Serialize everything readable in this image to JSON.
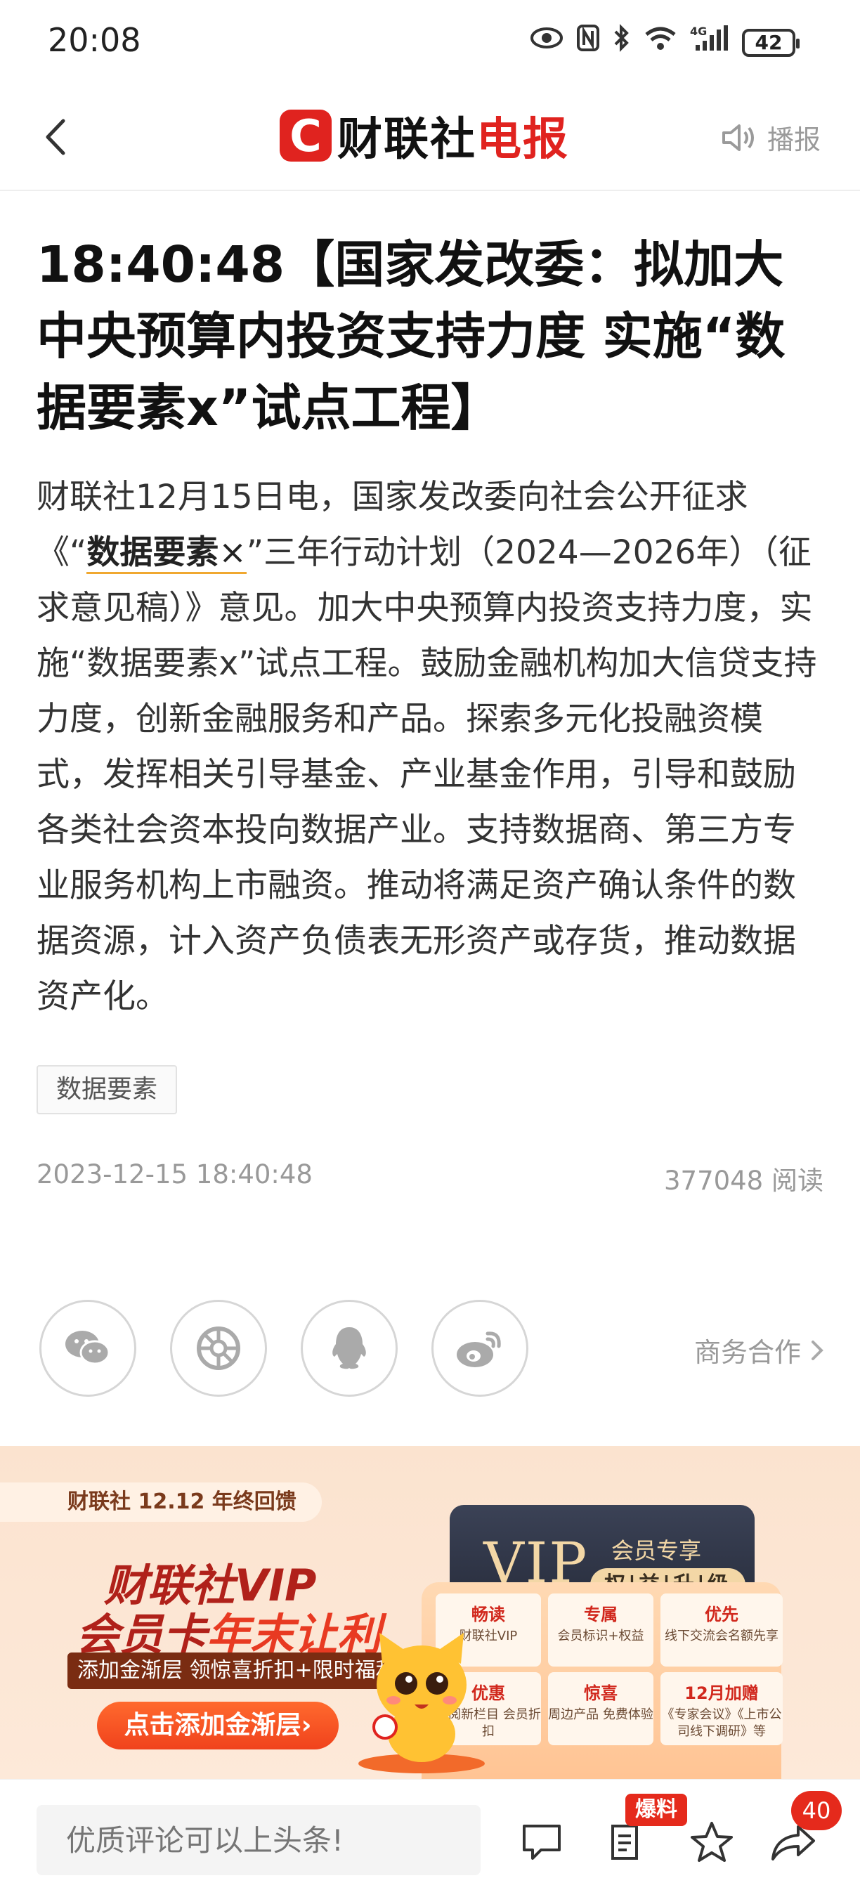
{
  "status_bar": {
    "time": "20:08",
    "network": "4G",
    "battery": "42"
  },
  "header": {
    "logo_mark": "C",
    "logo_text_a": "财联社",
    "logo_text_b": "电报",
    "broadcast_label": "播报"
  },
  "article": {
    "headline": "18:40:48【国家发改委：拟加大中央预算内投资支持力度 实施“数据要素x”试点工程】",
    "body_prefix": "财联社12月15日电，国家发改委向社会公开征求《“",
    "body_keyword": "数据要素",
    "body_keyword_mark": "×",
    "body_rest": "”三年行动计划（2024—2026年）（征求意见稿）》意见。加大中央预算内投资支持力度，实施“数据要素x”试点工程。鼓励金融机构加大信贷支持力度，创新金融服务和产品。探索多元化投融资模式，发挥相关引导基金、产业基金作用，引导和鼓励各类社会资本投向数据产业。支持数据商、第三方专业服务机构上市融资。推动将满足资产确认条件的数据资源，计入资产负债表无形资产或存货，推动数据资产化。",
    "tag": "数据要素",
    "datetime": "2023-12-15 18:40:48",
    "reads": "377048 阅读"
  },
  "share": {
    "business_link": "商务合作"
  },
  "banner": {
    "pill": "财联社 12.12 年终回馈",
    "title_line1": "财联社VIP",
    "title_line2_a": "会员卡",
    "title_line2_b": "年末让利",
    "strip": "添加金渐层 领惊喜折扣+限时福利",
    "cta": "点击添加金渐层›",
    "vip_logo": "VIP",
    "vip_exclusive": "会员专享",
    "vip_badge": "权|益|升|级",
    "benefits": [
      {
        "title": "畅读",
        "desc": "财联社VIP"
      },
      {
        "title": "专属",
        "desc": "会员标识+权益"
      },
      {
        "title": "优先",
        "desc": "线下交流会名额先享"
      },
      {
        "title": "优惠",
        "desc": "订阅新栏目 会员折扣"
      },
      {
        "title": "惊喜",
        "desc": "周边产品 免费体验"
      },
      {
        "title": "12月加赠",
        "desc": "《专家会议》《上市公司线下调研》等"
      }
    ]
  },
  "bottom_bar": {
    "comment_placeholder": "优质评论可以上头条!",
    "tip_badge": "爆料",
    "share_count": "40"
  }
}
